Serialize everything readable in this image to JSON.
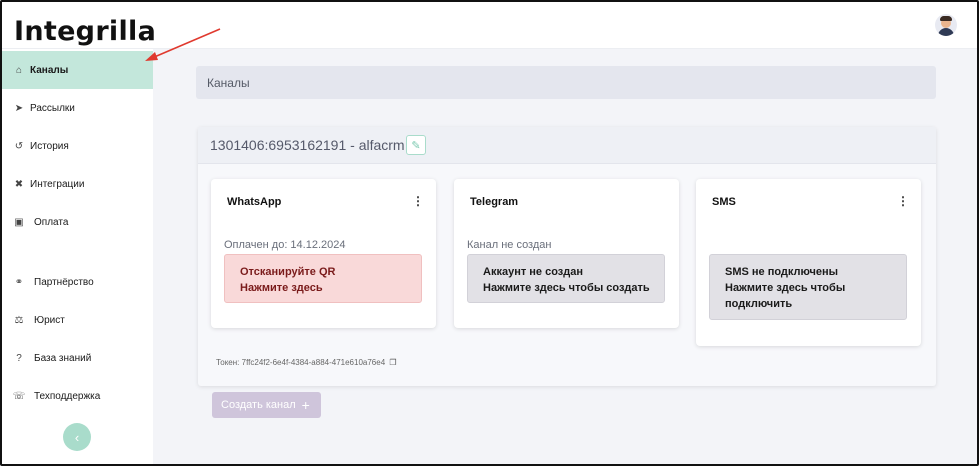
{
  "app": {
    "logo": "Integrilla"
  },
  "sidebar": {
    "items": [
      {
        "label": "Каналы",
        "icon": "home-icon"
      },
      {
        "label": "Рассылки",
        "icon": "send-icon"
      },
      {
        "label": "История",
        "icon": "history-icon"
      },
      {
        "label": "Интеграции",
        "icon": "tools-icon"
      },
      {
        "label": "Оплата",
        "icon": "payment-icon"
      },
      {
        "label": "Партнёрство",
        "icon": "handshake-icon"
      },
      {
        "label": "Юрист",
        "icon": "scales-icon"
      },
      {
        "label": "База знаний",
        "icon": "question-icon"
      },
      {
        "label": "Техподдержка",
        "icon": "headset-icon"
      }
    ],
    "collapse_icon": "chevron-left-icon"
  },
  "breadcrumb": {
    "label": "Каналы"
  },
  "panel": {
    "title": "1301406:6953162191 - alfacrm",
    "edit_icon": "pencil-icon",
    "token": "Токен: 7ffc24f2-6e4f-4384-a884-471e610a76e4",
    "token_icon": "copy-icon",
    "cards": [
      {
        "title": "WhatsApp",
        "status": "Оплачен до: 14.12.2024",
        "alert_line1": "Отсканируйте QR",
        "alert_line2": "Нажмите здесь"
      },
      {
        "title": "Telegram",
        "status": "Канал не создан",
        "alert_line1": "Аккаунт не создан",
        "alert_line2": "Нажмите здесь чтобы создать"
      },
      {
        "title": "SMS",
        "alert_line1": "SMS не подключены",
        "alert_line2": "Нажмите здесь чтобы",
        "alert_line3": "подключить"
      }
    ]
  },
  "add_channel": {
    "label": "Создать канал",
    "icon": "plus-icon"
  },
  "colors": {
    "accent": "#c3e7db",
    "alert_red": "#f9d9d9",
    "alert_grey": "#e2e1e6",
    "add_button": "#cfc5db",
    "arrow": "#e03a2f"
  }
}
